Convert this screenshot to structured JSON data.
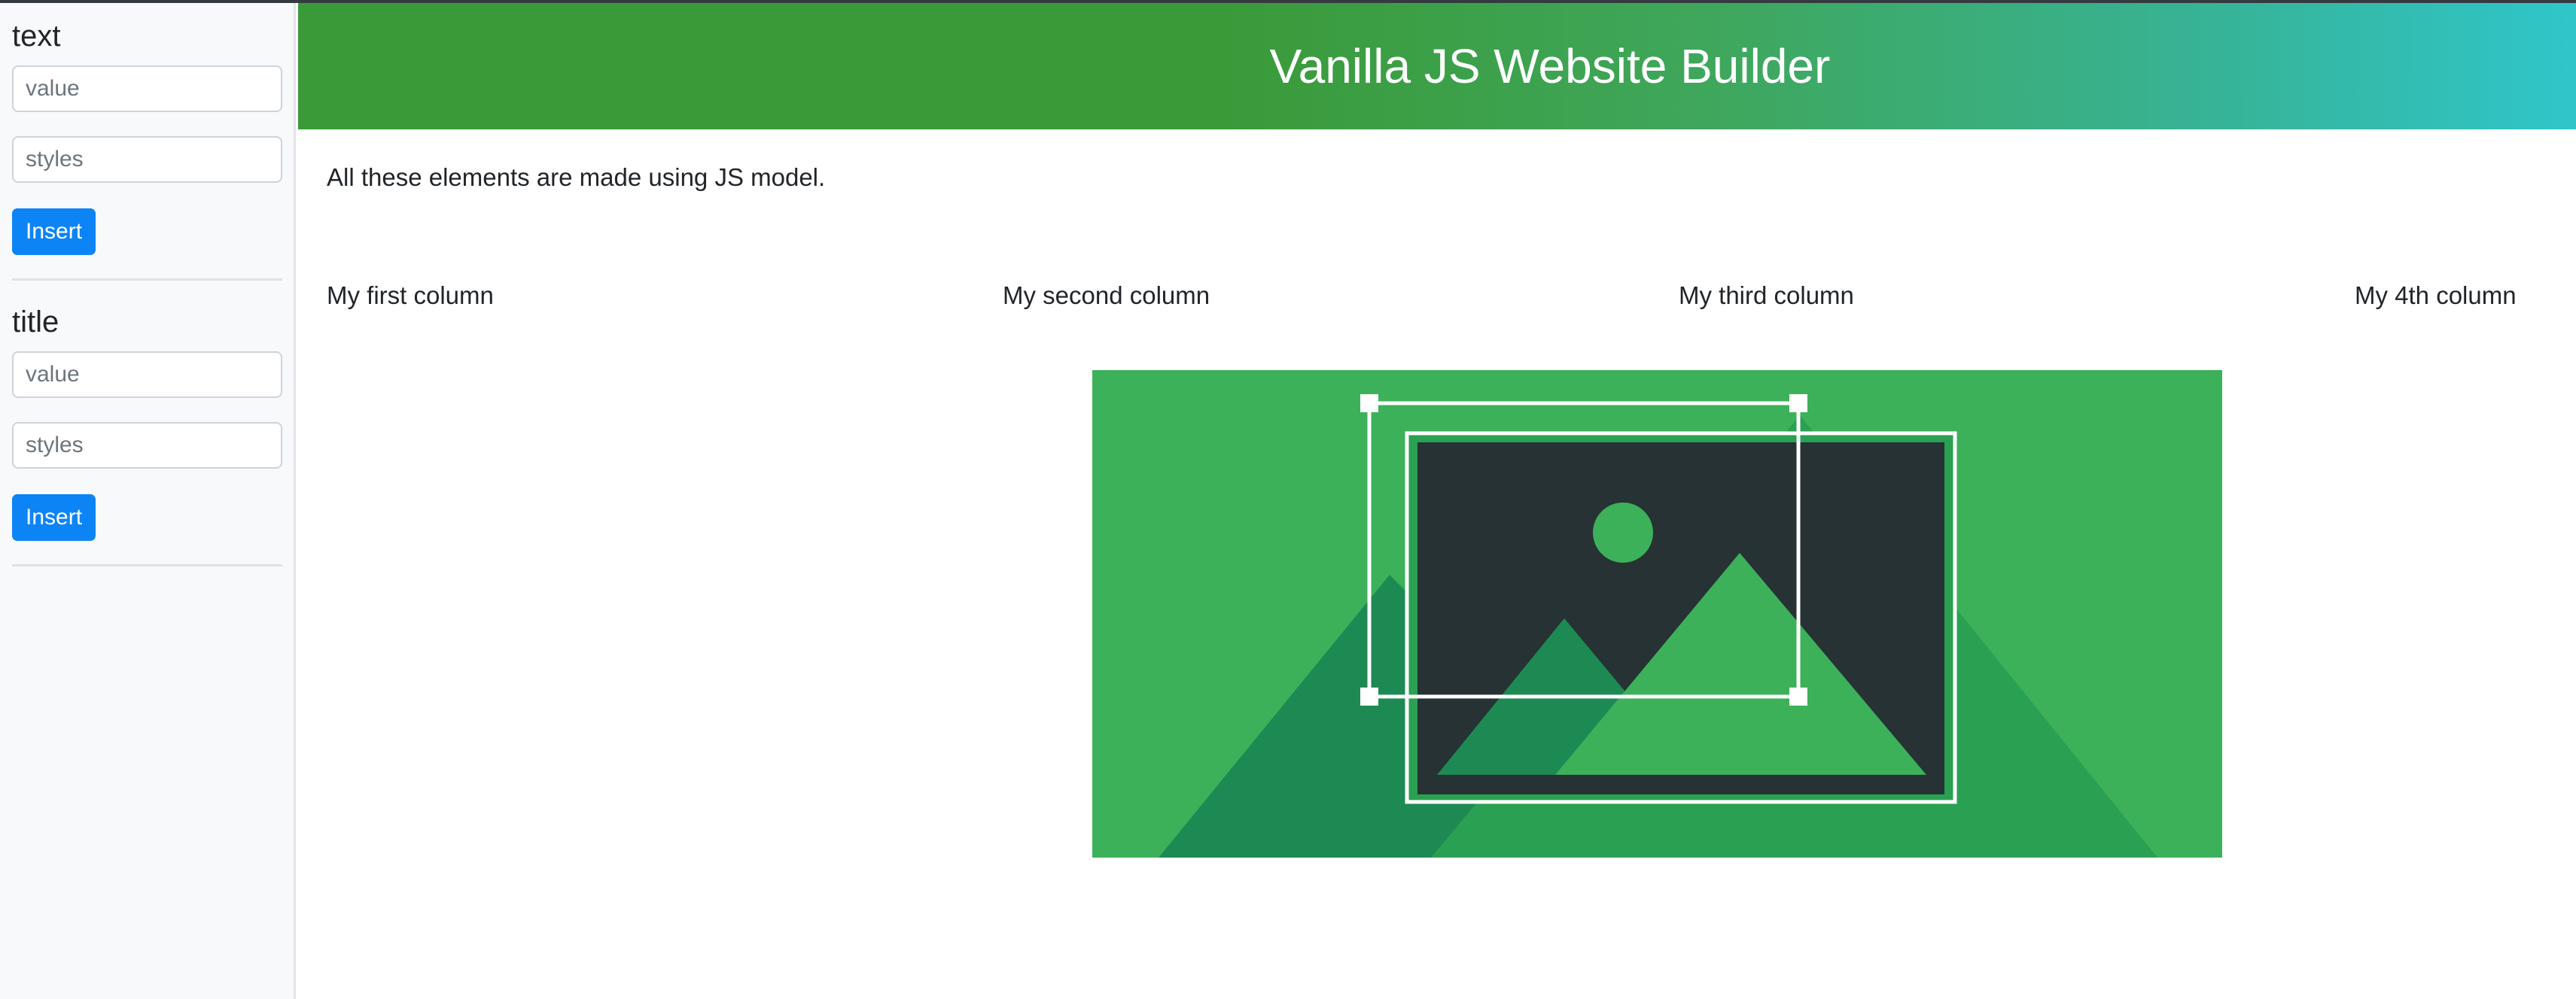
{
  "sidebar": {
    "panels": [
      {
        "title": "text",
        "value_placeholder": "value",
        "styles_placeholder": "styles",
        "button_label": "Insert"
      },
      {
        "title": "title",
        "value_placeholder": "value",
        "styles_placeholder": "styles",
        "button_label": "Insert"
      }
    ]
  },
  "header": {
    "title": "Vanilla JS Website Builder",
    "gradient_colors": [
      "#3a9a38",
      "#3fa75c",
      "#37b396",
      "#2fc6ca"
    ]
  },
  "main": {
    "intro": "All these elements are made using JS model.",
    "columns": [
      "My first column",
      "My second column",
      "My third column",
      "My 4th column"
    ],
    "image": {
      "icon": "image-placeholder-icon",
      "background_color": "#3cb15a",
      "frame_color": "#263233"
    }
  },
  "colors": {
    "accent_button": "#0d84f5",
    "sidebar_bg": "#f8f9fa"
  }
}
